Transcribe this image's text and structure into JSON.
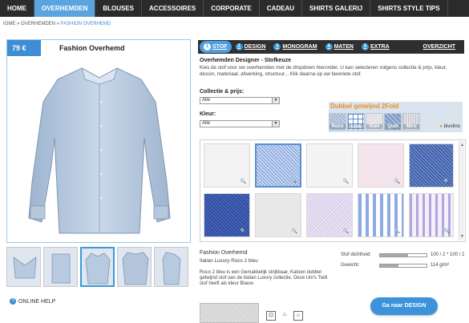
{
  "nav": {
    "items": [
      "HOME",
      "OVERHEMDEN",
      "BLOUSES",
      "ACCESSOIRES",
      "CORPORATE",
      "CADEAU",
      "SHIRTS GALERIJ",
      "SHIRTS STYLE TIPS"
    ],
    "active_index": 1
  },
  "breadcrumb": {
    "prefix": "IOME » OVERHEMDEN » ",
    "current": "FASHION OVERHEMD"
  },
  "product": {
    "price": "79 €",
    "title": "Fashion Overhemd"
  },
  "help_label": "ONLINE HELP",
  "tabs": [
    {
      "num": "1",
      "label": "STOF",
      "active": true
    },
    {
      "num": "2",
      "label": "DESIGN",
      "active": false
    },
    {
      "num": "3",
      "label": "MONOGRAM",
      "active": false
    },
    {
      "num": "4",
      "label": "MATEN",
      "active": false
    },
    {
      "num": "5",
      "label": "EXTRA",
      "active": false
    }
  ],
  "overview_label": "OVERZICHT",
  "section": {
    "title": "Overhemden Designer - Stofkeuze",
    "description": "Kies de stof voor uw overhemden met de dropdown hieronder. U kan selecteren volgens collectie & prijs, kleur, dessin, materiaal, afwerking, structuur... Klik daarna op uw favoriete stof."
  },
  "filters": {
    "collectie_label": "Collectie & prijs:",
    "collectie_value": "Alle",
    "kleur_label": "Kleur:",
    "kleur_value": "Alle"
  },
  "banner": {
    "title": "Dubbel getwijnd 2Fold",
    "swatches": [
      "Roco",
      "Lisa",
      "Kiwi",
      "Quilt",
      "Miro"
    ],
    "brand": "bivolino"
  },
  "fabric": {
    "name": "Fashion Overhemd",
    "subname": "Italian Luxury Roco 2 bleu",
    "description": "Roco 2 bleu is een Gemakkelijk strijkbaar, Katoen dubbel getwijnd stof van de Italian Luxury collectie. Deze Uni's Twill stof heeft als kleur Blauw.",
    "dichtheid_label": "Stof dichtheid:",
    "dichtheid_value": "100 / 2 * 100 / 2",
    "dichtheid_level": 0.6,
    "gewicht_label": "Gewicht:",
    "gewicht_value": "114 g/m²",
    "gewicht_level": 0.4
  },
  "cta_label": "Ga naar DESIGN",
  "colors": {
    "accent": "#3c93dc",
    "nav_bg": "#2b2b2b",
    "banner_orange": "#f08a1f"
  }
}
